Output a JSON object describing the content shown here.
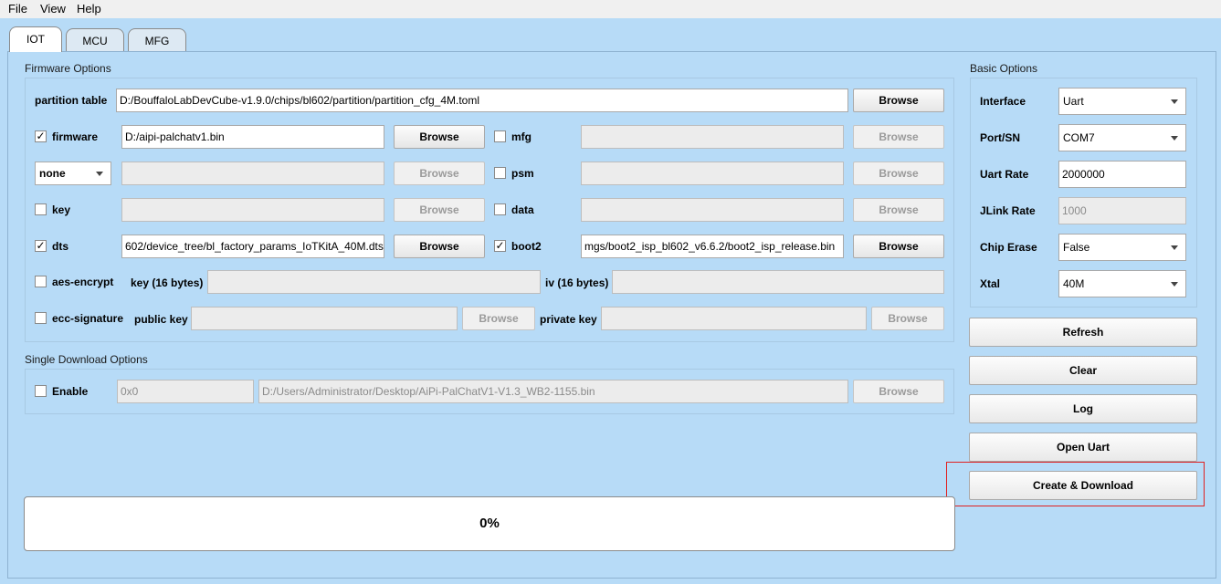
{
  "menu": {
    "file": "File",
    "view": "View",
    "help": "Help"
  },
  "tabs": [
    "IOT",
    "MCU",
    "MFG"
  ],
  "firmware_options": {
    "title": "Firmware Options",
    "partition_table": {
      "label": "partition table",
      "value": "D:/BouffaloLabDevCube-v1.9.0/chips/bl602/partition/partition_cfg_4M.toml",
      "button": "Browse"
    },
    "firmware": {
      "label": "firmware",
      "checked": true,
      "value": "D:/aipi-palchatv1.bin",
      "button": "Browse"
    },
    "mfg": {
      "label": "mfg",
      "checked": false,
      "value": "",
      "button": "Browse"
    },
    "none_select": {
      "value": "none",
      "field": "",
      "button": "Browse"
    },
    "psm": {
      "label": "psm",
      "checked": false,
      "value": "",
      "button": "Browse"
    },
    "key": {
      "label": "key",
      "checked": false,
      "value": "",
      "button": "Browse"
    },
    "data": {
      "label": "data",
      "checked": false,
      "value": "",
      "button": "Browse"
    },
    "dts": {
      "label": "dts",
      "checked": true,
      "value": "602/device_tree/bl_factory_params_IoTKitA_40M.dts",
      "button": "Browse"
    },
    "boot2": {
      "label": "boot2",
      "checked": true,
      "value": "mgs/boot2_isp_bl602_v6.6.2/boot2_isp_release.bin",
      "button": "Browse"
    },
    "aes_encrypt": {
      "label": "aes-encrypt",
      "checked": false,
      "key_label": "key (16 bytes)",
      "iv_label": "iv (16 bytes)"
    },
    "ecc_signature": {
      "label": "ecc-signature",
      "checked": false,
      "public_key_label": "public key",
      "private_key_label": "private key",
      "button": "Browse"
    }
  },
  "single_download": {
    "title": "Single Download Options",
    "enable_label": "Enable",
    "checked": false,
    "address": "0x0",
    "file": "D:/Users/Administrator/Desktop/AiPi-PalChatV1-V1.3_WB2-1155.bin",
    "button": "Browse"
  },
  "basic_options": {
    "title": "Basic Options",
    "interface": {
      "label": "Interface",
      "value": "Uart"
    },
    "port": {
      "label": "Port/SN",
      "value": "COM7"
    },
    "uart_rate": {
      "label": "Uart Rate",
      "value": "2000000"
    },
    "jlink_rate": {
      "label": "JLink Rate",
      "value": "1000"
    },
    "chip_erase": {
      "label": "Chip Erase",
      "value": "False"
    },
    "xtal": {
      "label": "Xtal",
      "value": "40M"
    }
  },
  "actions": {
    "refresh": "Refresh",
    "clear": "Clear",
    "log": "Log",
    "open_uart": "Open Uart",
    "create_download": "Create & Download"
  },
  "progress": {
    "percent": 0,
    "label": "0%"
  },
  "colors": {
    "background": "#b7dbf7",
    "highlight": "#e02020"
  }
}
